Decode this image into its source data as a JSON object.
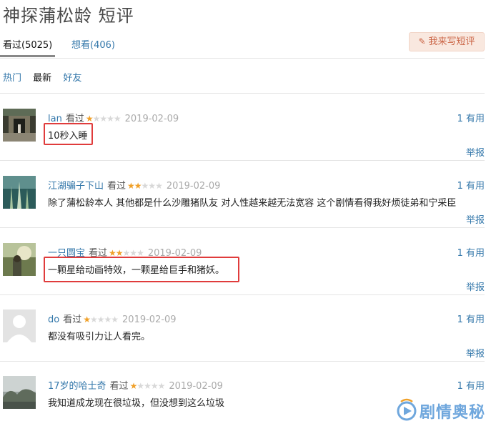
{
  "page": {
    "title": "神探蒲松龄 短评"
  },
  "tabs": [
    {
      "label": "看过(5025)",
      "active": true
    },
    {
      "label": "想看(406)",
      "active": false
    }
  ],
  "write_button": {
    "label": "我来写短评"
  },
  "filters": [
    "热门",
    "最新",
    "好友"
  ],
  "comments": [
    {
      "user": "lan",
      "status": "看过",
      "rating": 1,
      "date": "2019-02-09",
      "useful": "1 有用",
      "content": "10秒入睡",
      "report": "举报"
    },
    {
      "user": "江湖骗子下山",
      "status": "看过",
      "rating": 2,
      "date": "2019-02-09",
      "useful": "1 有用",
      "content": "除了蒲松龄本人 其他都是什么沙雕猪队友 对人性越来越无法宽容 这个剧情看得我好烦徒弟和宁采臣",
      "report": "举报"
    },
    {
      "user": "一只圆宝",
      "status": "看过",
      "rating": 2,
      "date": "2019-02-09",
      "useful": "1 有用",
      "content": "一颗星给动画特效，一颗星给巨手和猪妖。",
      "report": "举报"
    },
    {
      "user": "do",
      "status": "看过",
      "rating": 1,
      "date": "2019-02-09",
      "useful": "1 有用",
      "content": "都没有吸引力让人看完。",
      "report": "举报"
    },
    {
      "user": "17岁的哈士奇",
      "status": "看过",
      "rating": 1,
      "date": "2019-02-09",
      "useful": "1 有用",
      "content": "我知道成龙现在很垃圾，但没想到这么垃圾",
      "report": ""
    }
  ],
  "watermark": {
    "text": "剧情奥秘"
  },
  "colors": {
    "link": "#3377aa",
    "highlight": "#e03c3c",
    "star": "#f0a028",
    "button_bg": "#f9e8df",
    "button_text": "#ca6445"
  }
}
